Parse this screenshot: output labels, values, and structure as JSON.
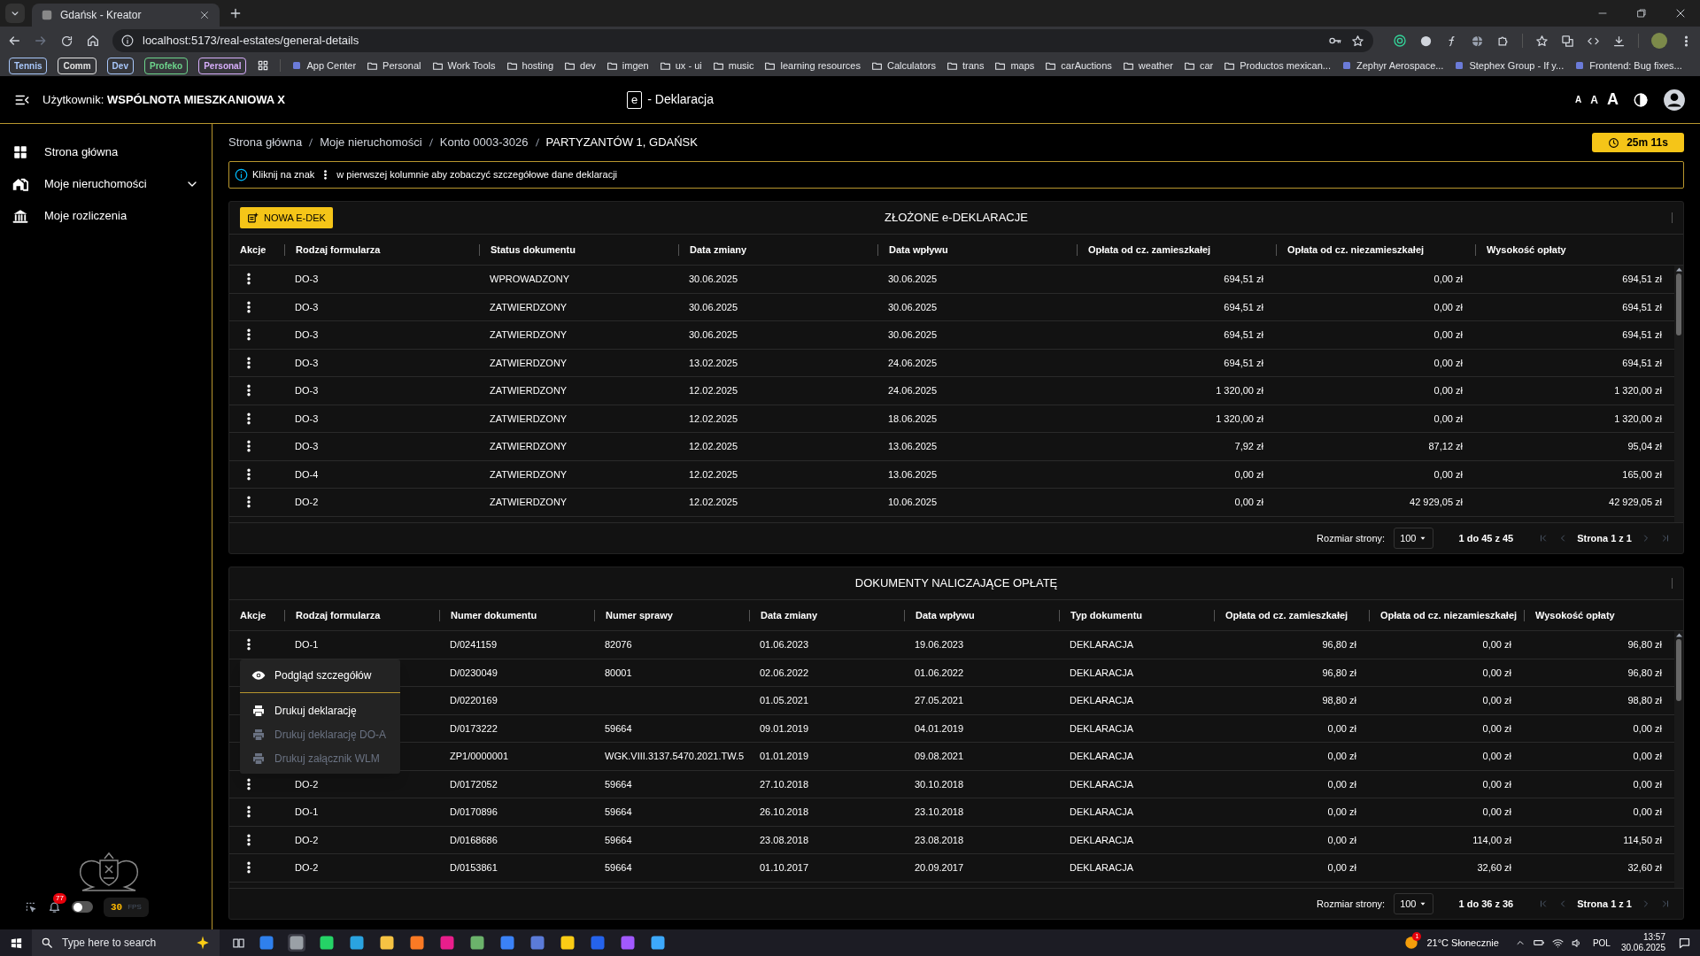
{
  "browser": {
    "tab": {
      "title": "Gdańsk - Kreator",
      "selected": true
    },
    "url": "localhost:5173/real-estates/general-details",
    "bookmarks": [
      {
        "kind": "group",
        "label": "Tennis",
        "color": "#a8c7fa"
      },
      {
        "kind": "group",
        "label": "Comm",
        "color": "#e3e3e3"
      },
      {
        "kind": "group",
        "label": "Dev",
        "color": "#a8c7fa"
      },
      {
        "kind": "group",
        "label": "Profeko",
        "color": "#6dd58c"
      },
      {
        "kind": "group",
        "label": "Personal",
        "color": "#d7aefb"
      },
      {
        "kind": "site",
        "label": "App Center"
      },
      {
        "kind": "folder",
        "label": "Personal"
      },
      {
        "kind": "folder",
        "label": "Work Tools"
      },
      {
        "kind": "folder",
        "label": "hosting"
      },
      {
        "kind": "folder",
        "label": "dev"
      },
      {
        "kind": "folder",
        "label": "imgen"
      },
      {
        "kind": "folder",
        "label": "ux - ui"
      },
      {
        "kind": "folder",
        "label": "music"
      },
      {
        "kind": "folder",
        "label": "learning resources"
      },
      {
        "kind": "folder",
        "label": "Calculators"
      },
      {
        "kind": "folder",
        "label": "trans"
      },
      {
        "kind": "folder",
        "label": "maps"
      },
      {
        "kind": "folder",
        "label": "carAuctions"
      },
      {
        "kind": "folder",
        "label": "weather"
      },
      {
        "kind": "folder",
        "label": "car"
      },
      {
        "kind": "folder",
        "label": "Productos mexican..."
      },
      {
        "kind": "site",
        "label": "Zephyr Aerospace..."
      },
      {
        "kind": "site",
        "label": "Stephex Group - If y..."
      },
      {
        "kind": "site",
        "label": "Frontend: Bug fixes..."
      }
    ]
  },
  "header": {
    "user": "Użytkownik: **WSPÓLNOTA MIESZKANIOWA X**",
    "logo_letter": "e",
    "title": "- Deklaracja",
    "font_sizes": [
      "A",
      "A",
      "A"
    ]
  },
  "sidebar": {
    "items": [
      {
        "label": "Strona główna",
        "kind": "link"
      },
      {
        "label": "Moje nieruchomości",
        "kind": "group"
      },
      {
        "label": "Moje rozliczenia",
        "kind": "link"
      }
    ],
    "notifications": "77",
    "toggle": {
      "on": false
    },
    "fps": "30",
    "fps_unit": "FPS"
  },
  "breadcrumb": [
    "Strona główna",
    "Moje nieruchomości",
    "Konto 0003-3026",
    "PARTYZANTÓW 1, GDAŃSK"
  ],
  "timer": "25m 11s",
  "info": {
    "before": "Kliknij na znak",
    "after": "w pierwszej kolumnie aby zobaczyć szczegółowe dane deklaracji"
  },
  "declarations": {
    "title": "ZŁOŻONE e-DEKLARACJE",
    "new_button": "NOWA E-DEK",
    "columns": [
      "Akcje",
      "Rodzaj formularza",
      "Status dokumentu",
      "Data zmiany",
      "Data wpływu",
      "Opłata od cz. zamieszkałej",
      "Opłata od cz. niezamieszkałej",
      "Wysokość opłaty"
    ],
    "rows": [
      {
        "form": "DO-3",
        "status": "WPROWADZONY",
        "changed": "30.06.2025",
        "received": "30.06.2025",
        "fee_occupied": "694,51 zł",
        "fee_unoccupied": "0,00 zł",
        "total": "694,51 zł"
      },
      {
        "form": "DO-3",
        "status": "ZATWIERDZONY",
        "changed": "30.06.2025",
        "received": "30.06.2025",
        "fee_occupied": "694,51 zł",
        "fee_unoccupied": "0,00 zł",
        "total": "694,51 zł"
      },
      {
        "form": "DO-3",
        "status": "ZATWIERDZONY",
        "changed": "30.06.2025",
        "received": "30.06.2025",
        "fee_occupied": "694,51 zł",
        "fee_unoccupied": "0,00 zł",
        "total": "694,51 zł"
      },
      {
        "form": "DO-3",
        "status": "ZATWIERDZONY",
        "changed": "13.02.2025",
        "received": "24.06.2025",
        "fee_occupied": "694,51 zł",
        "fee_unoccupied": "0,00 zł",
        "total": "694,51 zł"
      },
      {
        "form": "DO-3",
        "status": "ZATWIERDZONY",
        "changed": "12.02.2025",
        "received": "24.06.2025",
        "fee_occupied": "1 320,00 zł",
        "fee_unoccupied": "0,00 zł",
        "total": "1 320,00 zł"
      },
      {
        "form": "DO-3",
        "status": "ZATWIERDZONY",
        "changed": "12.02.2025",
        "received": "18.06.2025",
        "fee_occupied": "1 320,00 zł",
        "fee_unoccupied": "0,00 zł",
        "total": "1 320,00 zł"
      },
      {
        "form": "DO-3",
        "status": "ZATWIERDZONY",
        "changed": "12.02.2025",
        "received": "13.06.2025",
        "fee_occupied": "7,92 zł",
        "fee_unoccupied": "87,12 zł",
        "total": "95,04 zł"
      },
      {
        "form": "DO-4",
        "status": "ZATWIERDZONY",
        "changed": "12.02.2025",
        "received": "13.06.2025",
        "fee_occupied": "0,00 zł",
        "fee_unoccupied": "0,00 zł",
        "total": "165,00 zł"
      },
      {
        "form": "DO-2",
        "status": "ZATWIERDZONY",
        "changed": "12.02.2025",
        "received": "10.06.2025",
        "fee_occupied": "0,00 zł",
        "fee_unoccupied": "42 929,05 zł",
        "total": "42 929,05 zł"
      }
    ],
    "pager": {
      "size_label": "Rozmiar strony:",
      "size": "100",
      "range": "1 do 45 z 45",
      "page": "Strona 1 z 1",
      "nav_disabled": true
    }
  },
  "documents": {
    "title": "DOKUMENTY NALICZAJĄCE OPŁATĘ",
    "columns": [
      "Akcje",
      "Rodzaj formularza",
      "Numer dokumentu",
      "Numer sprawy",
      "Data zmiany",
      "Data wpływu",
      "Typ dokumentu",
      "Opłata od cz. zamieszkałej",
      "Opłata od cz. niezamieszkałej",
      "Wysokość opłaty"
    ],
    "rows": [
      {
        "form": "DO-1",
        "doc_no": "D/0241159",
        "case_no": "82076",
        "changed": "01.06.2023",
        "received": "19.06.2023",
        "type": "DEKLARACJA",
        "fee_occupied": "96,80 zł",
        "fee_unoccupied": "0,00 zł",
        "total": "96,80 zł"
      },
      {
        "doc_no": "D/0230049",
        "case_no": "80001",
        "changed": "02.06.2022",
        "received": "01.06.2022",
        "type": "DEKLARACJA",
        "fee_occupied": "96,80 zł",
        "fee_unoccupied": "0,00 zł",
        "total": "96,80 zł"
      },
      {
        "doc_no": "D/0220169",
        "changed": "01.05.2021",
        "received": "27.05.2021",
        "type": "DEKLARACJA",
        "fee_occupied": "98,80 zł",
        "fee_unoccupied": "0,00 zł",
        "total": "98,80 zł"
      },
      {
        "doc_no": "D/0173222",
        "case_no": "59664",
        "changed": "09.01.2019",
        "received": "04.01.2019",
        "type": "DEKLARACJA",
        "fee_occupied": "0,00 zł",
        "fee_unoccupied": "0,00 zł",
        "total": "0,00 zł"
      },
      {
        "doc_no": "ZP1/0000001",
        "case_no": "WGK.VIII.3137.5470.2021.TW.5",
        "changed": "01.01.2019",
        "received": "09.08.2021",
        "type": "DEKLARACJA",
        "fee_occupied": "0,00 zł",
        "fee_unoccupied": "0,00 zł",
        "total": "0,00 zł"
      },
      {
        "form": "DO-2",
        "doc_no": "D/0172052",
        "case_no": "59664",
        "changed": "27.10.2018",
        "received": "30.10.2018",
        "type": "DEKLARACJA",
        "fee_occupied": "0,00 zł",
        "fee_unoccupied": "0,00 zł",
        "total": "0,00 zł"
      },
      {
        "form": "DO-1",
        "doc_no": "D/0170896",
        "case_no": "59664",
        "changed": "26.10.2018",
        "received": "23.10.2018",
        "type": "DEKLARACJA",
        "fee_occupied": "0,00 zł",
        "fee_unoccupied": "0,00 zł",
        "total": "0,00 zł"
      },
      {
        "form": "DO-2",
        "doc_no": "D/0168686",
        "case_no": "59664",
        "changed": "23.08.2018",
        "received": "23.08.2018",
        "type": "DEKLARACJA",
        "fee_occupied": "0,00 zł",
        "fee_unoccupied": "114,00 zł",
        "total": "114,50 zł"
      },
      {
        "form": "DO-2",
        "doc_no": "D/0153861",
        "case_no": "59664",
        "changed": "01.10.2017",
        "received": "20.09.2017",
        "type": "DEKLARACJA",
        "fee_occupied": "0,00 zł",
        "fee_unoccupied": "32,60 zł",
        "total": "32,60 zł"
      }
    ],
    "menu": [
      {
        "label": "Podgląd szczegółów",
        "kind": "view",
        "disabled": false
      },
      {
        "label": "Drukuj deklarację",
        "kind": "print",
        "disabled": false
      },
      {
        "label": "Drukuj deklarację DO-A",
        "kind": "print",
        "disabled": true
      },
      {
        "label": "Drukuj załącznik WLM",
        "kind": "print",
        "disabled": true
      }
    ],
    "pager": {
      "size_label": "Rozmiar strony:",
      "size": "100",
      "range": "1 do 36 z 36",
      "page": "Strona 1 z 1",
      "nav_disabled": true
    }
  },
  "taskbar": {
    "search_placeholder": "Type here to search",
    "weather_badge": "1",
    "weather": "21°C Słonecznie",
    "language": "POL",
    "time": "13:57",
    "date": "30.06.2025"
  }
}
